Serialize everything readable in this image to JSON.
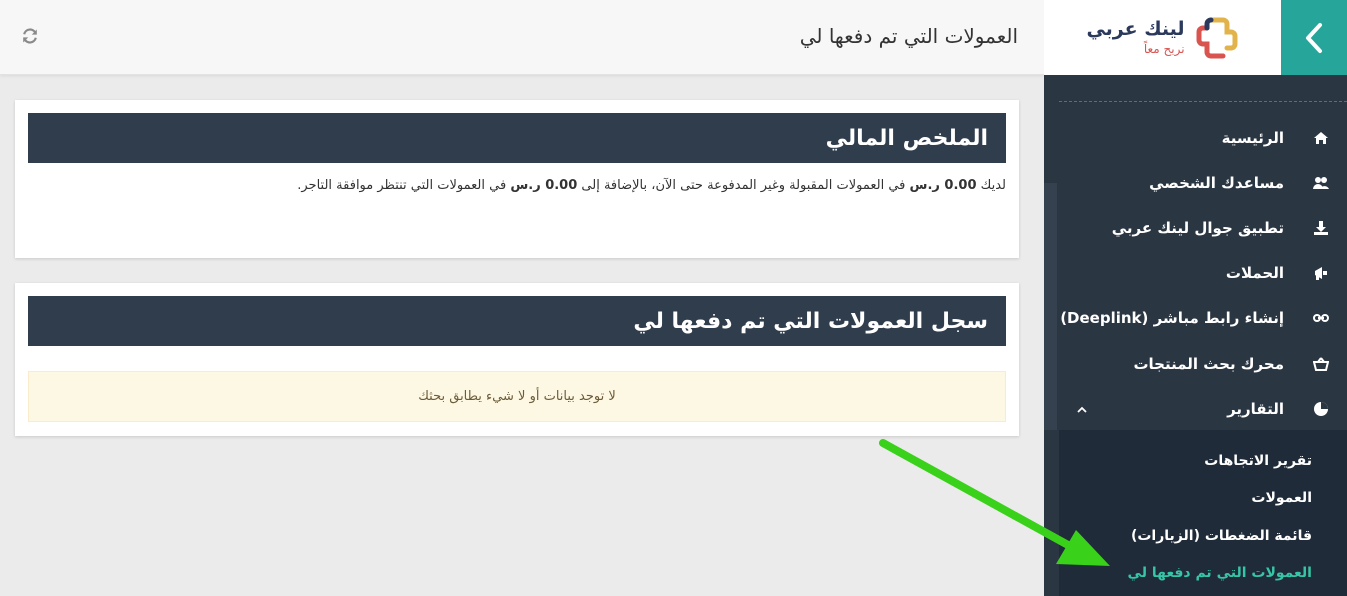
{
  "header": {
    "title": "العمولات التي تم دفعها لي",
    "refresh_icon": "refresh-icon"
  },
  "brand": {
    "name": "لينك عربي",
    "tagline": "نربح معاً",
    "colors": {
      "navy": "#2b3a5c",
      "red": "#d9534f",
      "gold": "#e2b34a"
    }
  },
  "sidebar": {
    "toggle_icon": "chevron-left-icon",
    "items": [
      {
        "label": "الرئيسية",
        "icon": "home-icon"
      },
      {
        "label": "مساعدك الشخصي",
        "icon": "users-icon"
      },
      {
        "label": "تطبيق جوال لينك عربي",
        "icon": "download-icon"
      },
      {
        "label": "الحملات",
        "icon": "campaign-icon"
      },
      {
        "label": "إنشاء رابط مباشر (Deeplink)",
        "icon": "link-icon"
      },
      {
        "label": "محرك بحث المنتجات",
        "icon": "basket-icon"
      },
      {
        "label": "التقارير",
        "icon": "pie-chart-icon",
        "expanded": true
      }
    ],
    "submenu": [
      {
        "label": "تقرير الاتجاهات"
      },
      {
        "label": "العمولات"
      },
      {
        "label": "قائمة الضغطات (الزيارات)"
      },
      {
        "label": "العمولات التي تم دفعها لي",
        "active": true
      }
    ]
  },
  "summary": {
    "title": "الملخص المالي",
    "text_1": "لديك",
    "amount_1": "0.00 ر.س",
    "text_2": "في العمولات المقبولة وغير المدفوعة حتى الآن، بالإضافة إلى",
    "amount_2": "0.00 ر.س",
    "text_3": "في العمولات التي تنتظر موافقة التاجر."
  },
  "history": {
    "title": "سجل العمولات التي تم دفعها لي",
    "empty_message": "لا توجد بيانات أو لا شيء يطابق بحثك"
  },
  "colors": {
    "accent": "#26a69a",
    "sidebar_bg": "#2b3643",
    "active_link": "#36c6a7",
    "portlet_title_bg": "#2f3d4d",
    "annotation_arrow": "#3ad11a"
  }
}
